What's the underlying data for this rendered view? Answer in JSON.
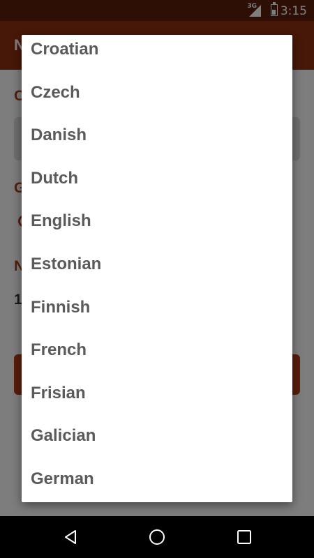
{
  "status_bar": {
    "network": "3G",
    "time": "3:15"
  },
  "app_bar": {
    "title": "N"
  },
  "background": {
    "label_1": "C",
    "label_2": "G",
    "label_3": "N",
    "value_text": "1"
  },
  "dropdown": {
    "items": [
      "Croatian",
      "Czech",
      "Danish",
      "Dutch",
      "English",
      "Estonian",
      "Finnish",
      "French",
      "Frisian",
      "Galician",
      "German"
    ]
  },
  "nav": {
    "back": "back-icon",
    "home": "home-icon",
    "recents": "recents-icon"
  },
  "colors": {
    "status_bar": "#5b1f0a",
    "app_bar": "#8f2e10",
    "accent": "#b03a14",
    "item_text": "#5a5a5a"
  }
}
